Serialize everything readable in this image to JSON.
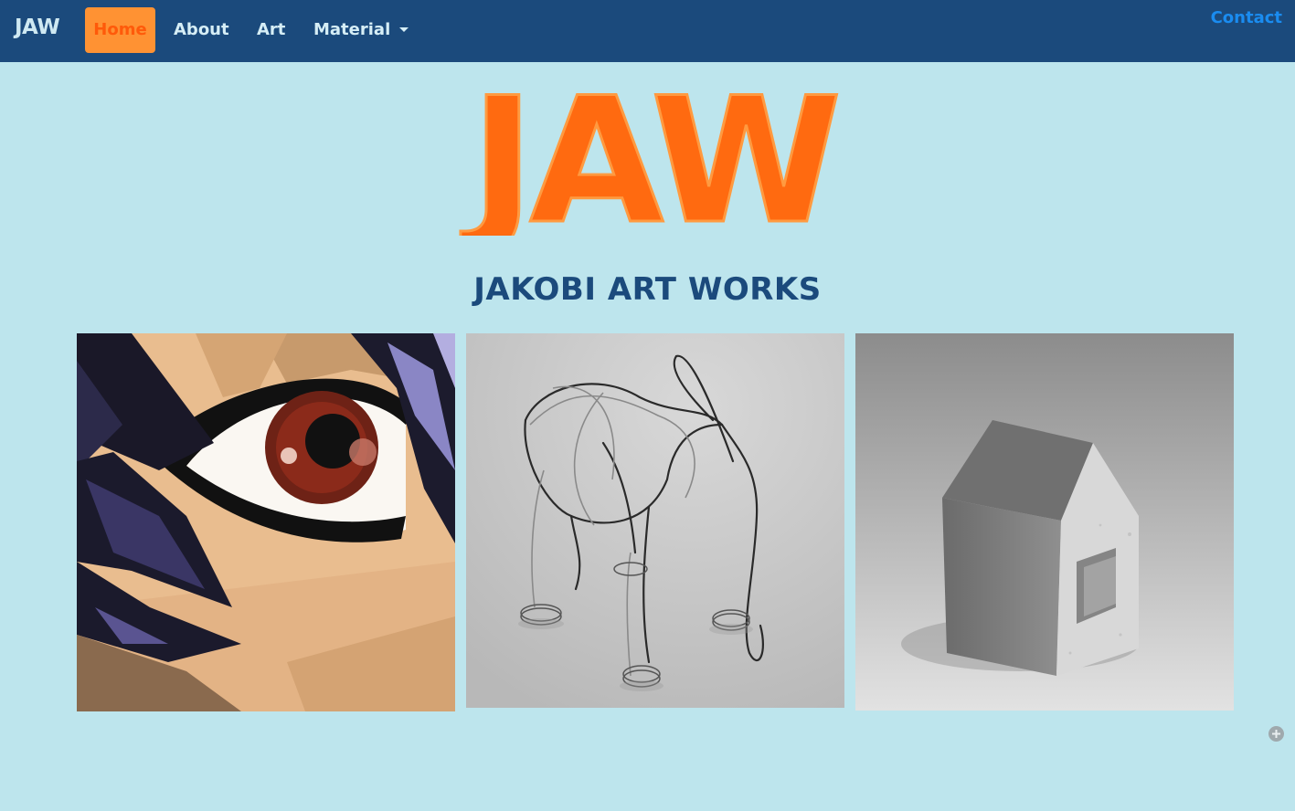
{
  "navbar": {
    "brand": "JAW",
    "items": [
      {
        "label": "Home",
        "active": true
      },
      {
        "label": "About"
      },
      {
        "label": "Art"
      },
      {
        "label": "Material"
      }
    ],
    "contact": "Contact"
  },
  "hero": {
    "logo_text": "JAW",
    "tagline": "JAKOBI ART WORKS"
  },
  "gallery": {
    "images": [
      {
        "name": "anime-eye-painting"
      },
      {
        "name": "wire-elephant-sculpture"
      },
      {
        "name": "concrete-house-sculpture"
      }
    ]
  },
  "colors": {
    "navbar": "#1b4a7c",
    "background": "#bde5ed",
    "accent": "#ff6a10",
    "active_tab": "#ff9233",
    "contact_link": "#1a8cf0"
  },
  "icons": {
    "dropdown": "chevron-down-icon",
    "corner": "plus-circle-icon"
  }
}
